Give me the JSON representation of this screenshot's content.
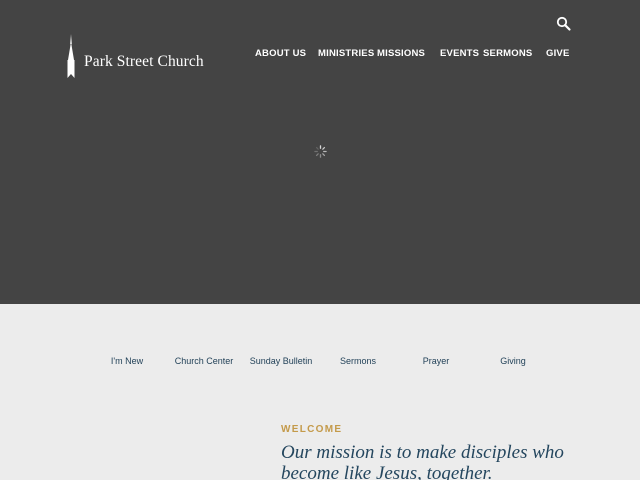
{
  "header": {
    "site_name": "Park Street Church",
    "nav": [
      {
        "label": "ABOUT US"
      },
      {
        "label": "MINISTRIES"
      },
      {
        "label": "MISSIONS"
      },
      {
        "label": "EVENTS"
      },
      {
        "label": "SERMONS"
      },
      {
        "label": "GIVE"
      }
    ]
  },
  "quick_links": [
    {
      "label": "I'm New"
    },
    {
      "label": "Church Center"
    },
    {
      "label": "Sunday Bulletin"
    },
    {
      "label": "Sermons"
    },
    {
      "label": "Prayer"
    },
    {
      "label": "Giving"
    }
  ],
  "welcome": {
    "label": "WELCOME",
    "mission": "Our mission is to make disciples who become like Jesus, together."
  },
  "colors": {
    "hero_bg": "#444444",
    "page_bg": "#ececec",
    "accent_gold": "#c49a4a",
    "link_navy": "#1f3f56"
  },
  "icons": {
    "search": "search-icon",
    "logo": "steeple-icon",
    "loader": "spinner-icon"
  }
}
